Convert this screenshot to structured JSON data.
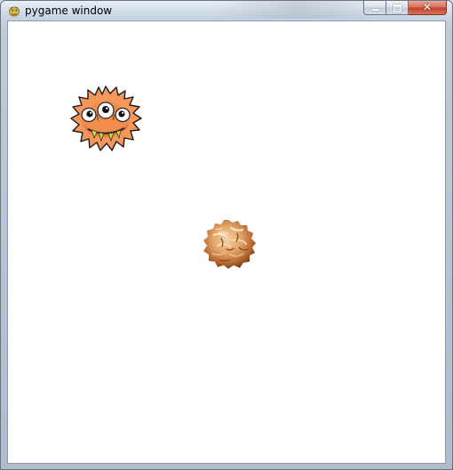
{
  "window": {
    "title": "pygame window",
    "icon": "pygame-snake-icon",
    "close_glyph": "✕"
  },
  "game": {
    "background": "#ffffff",
    "sprites": [
      {
        "name": "monster",
        "icon": "orange-three-eyed-monster"
      },
      {
        "name": "cookie",
        "icon": "coconut-macaroon-cookie"
      }
    ]
  }
}
